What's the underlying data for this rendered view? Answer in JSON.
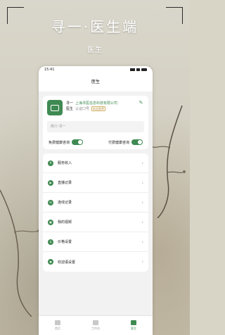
{
  "hero": {
    "title": "寻一·医生端",
    "subtitle": "医生"
  },
  "status_bar": {
    "time": "15:41"
  },
  "nav": {
    "title": "医生"
  },
  "profile": {
    "name": "寻一",
    "org": "上海寻医信息科技有限公司",
    "dept": "医生",
    "qualification": "认证口号",
    "badge": "执业医师",
    "intro_placeholder": "简介:寻一"
  },
  "toggles": [
    {
      "label": "免费健康咨询",
      "on": true
    },
    {
      "label": "付费健康咨询",
      "on": true
    }
  ],
  "menu": [
    {
      "label": "服务收入",
      "icon": "income-icon"
    },
    {
      "label": "直播记录",
      "icon": "live-icon"
    },
    {
      "label": "连线记录",
      "icon": "call-icon"
    },
    {
      "label": "我的视频",
      "icon": "video-icon"
    },
    {
      "label": "价格设置",
      "icon": "price-icon"
    },
    {
      "label": "欢迎语设置",
      "icon": "heart-icon"
    }
  ],
  "tabs": [
    {
      "label": "首页",
      "active": false
    },
    {
      "label": "工作台",
      "active": false
    },
    {
      "label": "医生",
      "active": true
    }
  ],
  "colors": {
    "accent": "#3f8a52"
  }
}
